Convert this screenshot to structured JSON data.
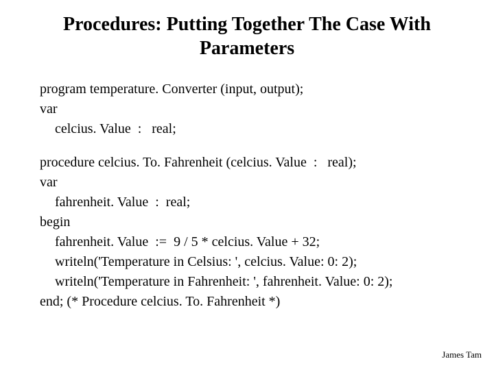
{
  "title": "Procedures: Putting Together The Case With Parameters",
  "code": {
    "l0": "program temperature. Converter (input, output);",
    "l1": "var",
    "l2": "celcius. Value  :   real;",
    "l3": "procedure celcius. To. Fahrenheit (celcius. Value  :   real);",
    "l4": "var",
    "l5": "fahrenheit. Value  :  real;",
    "l6": "begin",
    "l7": "fahrenheit. Value  :=  9 / 5 * celcius. Value + 32;",
    "l8": "writeln('Temperature in Celsius: ', celcius. Value: 0: 2);",
    "l9": "writeln('Temperature in Fahrenheit: ', fahrenheit. Value: 0: 2);",
    "l10": "end; (* Procedure celcius. To. Fahrenheit *)"
  },
  "footer": "James Tam"
}
